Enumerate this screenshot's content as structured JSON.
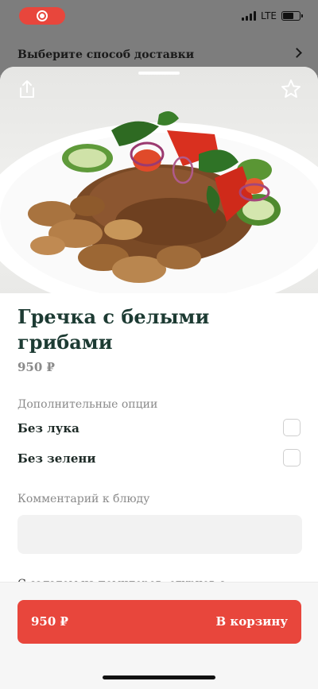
{
  "status_bar": {
    "network": "LTE"
  },
  "background": {
    "delivery_title": "Выберите способ доставки"
  },
  "icons": {
    "share": "share-icon",
    "favorite": "star-icon",
    "record": "record-icon",
    "chevron": "chevron-right-icon"
  },
  "dish": {
    "title": "Гречка с белыми грибами",
    "price": "950 ₽",
    "image_alt": "Гречка с белыми грибами и салатом"
  },
  "options": {
    "label": "Дополнительные опции",
    "items": [
      {
        "label": "Без лука",
        "checked": false
      },
      {
        "label": "Без зелени",
        "checked": false
      }
    ]
  },
  "comment": {
    "label": "Комментарий к блюду",
    "value": "",
    "placeholder": ""
  },
  "description": "С салатом из помидоров, огурцов с",
  "cart": {
    "price": "950 ₽",
    "label": "В корзину"
  },
  "colors": {
    "accent": "#e8463c",
    "title": "#1d3b33",
    "muted": "#8a8a8a"
  }
}
